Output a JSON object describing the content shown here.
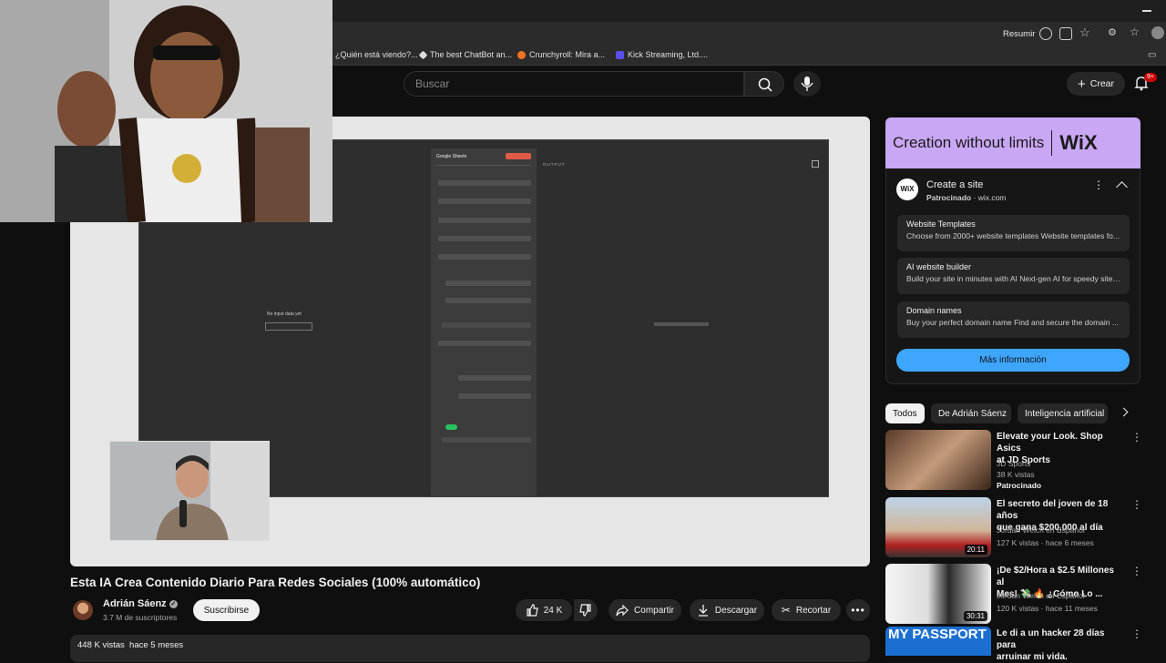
{
  "browser": {
    "resumir_label": "Resumir",
    "bookmarks": [
      "¿Quién está viendo?...",
      "The best ChatBot an...",
      "Crunchyroll: Mira a...",
      "Kick Streaming, Ltd...."
    ]
  },
  "header": {
    "search_placeholder": "Buscar",
    "create_label": "Crear",
    "notifications_badge": "9+"
  },
  "player": {
    "app_panel_title": "Google Sheets",
    "no_input_text": "No input data yet",
    "output_label": "OUTPUT"
  },
  "video": {
    "title": "Esta IA Crea Contenido Diario Para Redes Sociales (100% automático)",
    "channel_name": "Adrián Sáenz",
    "subscribers": "3.7 M de suscriptores",
    "subscribe_label": "Suscribirse",
    "likes": "24 K",
    "share_label": "Compartir",
    "download_label": "Descargar",
    "clip_label": "Recortar",
    "views": "448 K vistas",
    "published": "hace 5 meses"
  },
  "ad": {
    "banner_text": "Creation without limits",
    "brand": "WiX",
    "title": "Create a site",
    "sponsored": "Patrocinado",
    "domain": "wix.com",
    "items": [
      {
        "title": "Website Templates",
        "desc": "Choose from 2000+ website templates Website templates fo..."
      },
      {
        "title": "AI website builder",
        "desc": "Build your site in minutes with AI Next-gen AI for speedy site ..."
      },
      {
        "title": "Domain names",
        "desc": "Buy your perfect domain name Find and secure the domain ..."
      }
    ],
    "cta": "Más información"
  },
  "chips": [
    "Todos",
    "De Adrián Sáenz",
    "Inteligencia artificial"
  ],
  "recommendations": [
    {
      "title_l1": "Elevate your Look. Shop Asics",
      "title_l2": "at JD Sports",
      "channel": "JD Sports",
      "meta": "38 K vistas",
      "extra": "Patrocinado",
      "duration": ""
    },
    {
      "title_l1": "El secreto del joven de 18 años",
      "title_l2": "que gana $200,000 al día",
      "channel": "Jordan Welch en Español",
      "meta": "127 K vistas · hace 6 meses",
      "extra": "",
      "duration": "20:11"
    },
    {
      "title_l1": "¡De $2/Hora a $2.5 Millones al",
      "title_l2": "Mes! 💸 🔥 ¿Cómo Lo ...",
      "channel": "Jordan Welch en Español",
      "meta": "120 K vistas · hace 11 meses",
      "extra": "",
      "duration": "30:31"
    },
    {
      "title_l1": "Le di a un hacker 28 días para",
      "title_l2": "arruinar mi vida.",
      "channel": "",
      "meta": "",
      "extra": "",
      "duration": "",
      "thumb_text": "MY PASSPORT"
    }
  ],
  "colors": {
    "background": "#0f0f0f",
    "ad_banner": "#c9a7f5",
    "cta": "#3ea6ff",
    "notification": "#cc0000"
  }
}
